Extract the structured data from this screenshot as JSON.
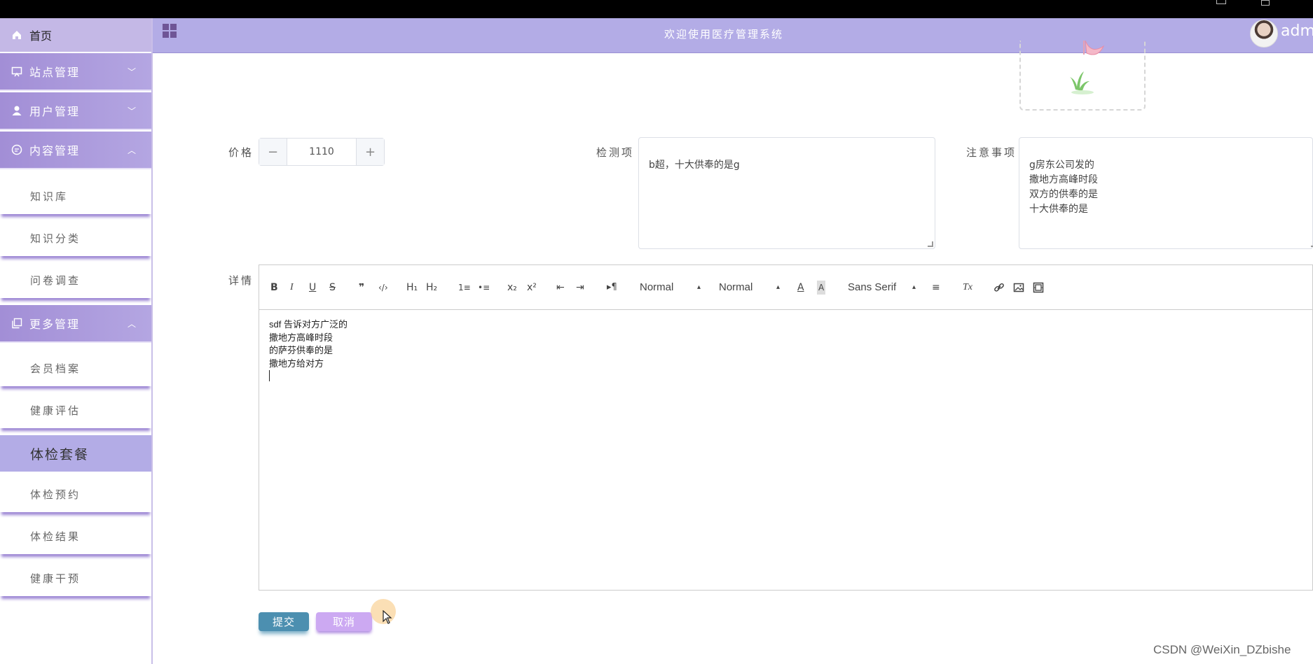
{
  "header": {
    "title": "欢迎使用医疗管理系统",
    "user": "admi"
  },
  "sidebar": {
    "home": "首页",
    "menus": [
      {
        "label": "站点管理",
        "icon": "monitor-icon",
        "expanded": false
      },
      {
        "label": "用户管理",
        "icon": "user-icon",
        "expanded": false
      },
      {
        "label": "内容管理",
        "icon": "chat-icon",
        "expanded": true
      },
      {
        "label": "更多管理",
        "icon": "copy-icon",
        "expanded": true
      }
    ],
    "content_items": [
      "知识库",
      "知识分类",
      "问卷调查"
    ],
    "more_items": [
      "会员档案",
      "健康评估",
      "体检套餐",
      "体检预约",
      "体检结果",
      "健康干预"
    ],
    "active_item": "体检套餐"
  },
  "form": {
    "price_label": "价格",
    "price_value": "1110",
    "minus": "−",
    "plus": "+",
    "check_label": "检测项",
    "check_value": "b超，十大供奉的是g",
    "notes_label": "注意事项",
    "notes_value": "g房东公司发的\n撒地方高峰时段\n双方的供奉的是\n十大供奉的是",
    "detail_label": "详情"
  },
  "editor": {
    "toolbar": {
      "bold": "B",
      "italic": "I",
      "underline": "U",
      "strike": "S",
      "blockquote": "❞",
      "code": "‹/›",
      "h1": "H₁",
      "h2": "H₂",
      "ordered": "1≡",
      "bullet": "•≡",
      "sub": "x₂",
      "sup": "x²",
      "outdent": "⇤",
      "indent": "⇥",
      "direction": "▸¶",
      "size": "Normal",
      "header": "Normal",
      "color": "A",
      "background": "A",
      "font": "Sans Serif",
      "align": "≡",
      "clean": "Tx",
      "link": "link",
      "image": "image",
      "video": "video"
    },
    "content": "sdf 告诉对方广泛的\n撒地方高峰时段\n的萨芬供奉的是\n撒地方给对方"
  },
  "actions": {
    "submit": "提交",
    "cancel": "取消"
  },
  "watermark": "CSDN @WeiXin_DZbishe"
}
